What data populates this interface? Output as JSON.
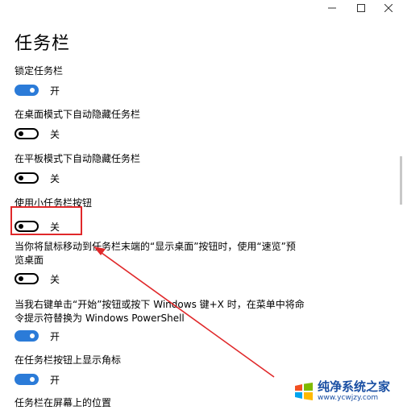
{
  "title": "任务栏",
  "settings": [
    {
      "label": "锁定任务栏",
      "state": "开"
    },
    {
      "label": "在桌面模式下自动隐藏任务栏",
      "state": "关"
    },
    {
      "label": "在平板模式下自动隐藏任务栏",
      "state": "关"
    },
    {
      "label": "使用小任务栏按钮",
      "state": "关"
    },
    {
      "label": "当你将鼠标移动到任务栏末端的“显示桌面”按钮时，使用“速览”预览桌面",
      "state": "关"
    },
    {
      "label": "当我右键单击“开始”按钮或按下 Windows 键+X 时，在菜单中将命令提示符替换为 Windows PowerShell",
      "state": "开"
    },
    {
      "label": "在任务栏按钮上显示角标",
      "state": "开"
    },
    {
      "label": "任务栏在屏幕上的位置"
    }
  ],
  "watermark": {
    "name": "纯净系统之家",
    "url": "www.ycwjzy.com"
  },
  "colors": {
    "toggle_on": "#2b7bd8",
    "highlight": "#e0282a"
  }
}
